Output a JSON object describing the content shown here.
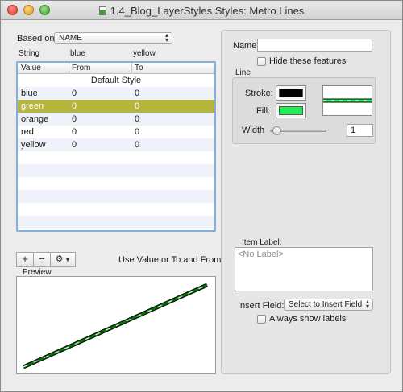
{
  "window": {
    "title": "1.4_Blog_LayerStyles Styles: Metro Lines"
  },
  "based_on": {
    "label": "Based on:",
    "value": "NAME"
  },
  "column_labels": {
    "string": "String",
    "from": "blue",
    "to": "yellow"
  },
  "table": {
    "headers": [
      "Value",
      "From",
      "To"
    ],
    "default_row": "Default Style",
    "rows": [
      {
        "value": "blue",
        "from": "0",
        "to": "0",
        "selected": false
      },
      {
        "value": "green",
        "from": "0",
        "to": "0",
        "selected": true
      },
      {
        "value": "orange",
        "from": "0",
        "to": "0",
        "selected": false
      },
      {
        "value": "red",
        "from": "0",
        "to": "0",
        "selected": false
      },
      {
        "value": "yellow",
        "from": "0",
        "to": "0",
        "selected": false
      }
    ],
    "selected_color": "#b6b540"
  },
  "toolbar": {
    "add_label": "+",
    "remove_label": "−",
    "gear_icon": "gear-icon",
    "hint": "Use Value or To and From"
  },
  "preview": {
    "label": "Preview",
    "line_color": "#0a6e0a",
    "dash_color": "#ffffff"
  },
  "right": {
    "name_label": "Name:",
    "name_value": "",
    "hide_label": "Hide these features",
    "hide_checked": false,
    "line_group": "Line",
    "stroke_label": "Stroke:",
    "stroke_color": "#000000",
    "fill_label": "Fill:",
    "fill_color": "#22ee55",
    "width_label": "Width",
    "width_value": "1",
    "width_slider_fraction": 0.05,
    "item_label_title": "Item Label:",
    "item_label_placeholder": "<No Label>",
    "insert_field_label": "Insert Field:",
    "insert_field_value": "Select to Insert Field",
    "always_show_label": "Always show labels",
    "always_show_checked": false
  }
}
